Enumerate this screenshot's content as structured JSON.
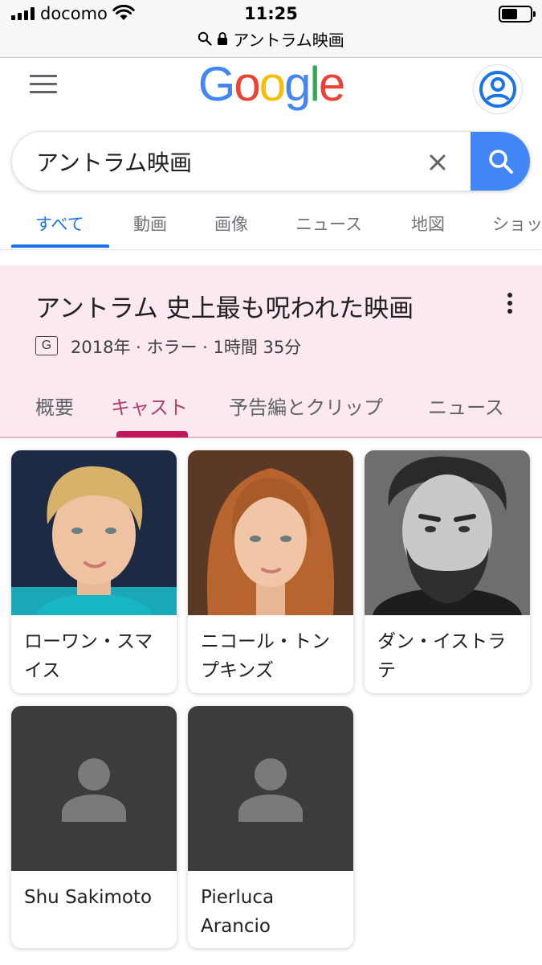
{
  "status_bar": {
    "carrier": "docomo",
    "time": "11:25",
    "url": "アントラム映画",
    "battery_level": 0.55
  },
  "header": {
    "logo_letters": [
      "G",
      "o",
      "o",
      "g",
      "l",
      "e"
    ]
  },
  "search": {
    "query": "アントラム映画"
  },
  "tabs": [
    {
      "label": "すべて",
      "active": true
    },
    {
      "label": "動画",
      "active": false
    },
    {
      "label": "画像",
      "active": false
    },
    {
      "label": "ニュース",
      "active": false
    },
    {
      "label": "地図",
      "active": false
    },
    {
      "label": "ショッ",
      "active": false
    }
  ],
  "knowledge": {
    "title": "アントラム 史上最も呪われた映画",
    "rating": "G",
    "meta": "2018年 · ホラー · 1時間 35分",
    "tabs": [
      {
        "label": "概要",
        "active": false
      },
      {
        "label": "キャスト",
        "active": true
      },
      {
        "label": "予告編とクリップ",
        "active": false
      },
      {
        "label": "ニュース",
        "active": false
      }
    ]
  },
  "cast": [
    {
      "name": "ローワン・スマイス",
      "has_photo": true
    },
    {
      "name": "ニコール・トンプキンズ",
      "has_photo": true
    },
    {
      "name": "ダン・イストラテ",
      "has_photo": true
    },
    {
      "name": "Shu Sakimoto",
      "has_photo": false
    },
    {
      "name": "Pierluca Arancio",
      "has_photo": false
    }
  ],
  "colors": {
    "accent_blue": "#1a73e8",
    "search_button": "#4285F4",
    "kp_background": "#fce8ef",
    "kp_active_tab": "#c2185b"
  }
}
